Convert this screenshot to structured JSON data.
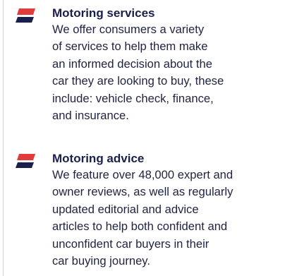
{
  "colors": {
    "flag_red": "#e23b3b",
    "flag_navy": "#1b1f4b",
    "divider": "#cfd2dc"
  },
  "items": [
    {
      "icon": "flag-icon",
      "title": "Motoring services",
      "lines": [
        "We offer consumers a variety",
        "of services to help them make",
        "an informed decision about the",
        "car they are looking to buy, these",
        "include: vehicle check, finance,",
        "and insurance."
      ]
    },
    {
      "icon": "flag-icon",
      "title": "Motoring advice",
      "lines": [
        "We feature over 48,000 expert and",
        "owner reviews, as well as regularly",
        "updated editorial and advice",
        "articles to help both confident and",
        "unconfident car buyers in their",
        "car buying journey."
      ]
    }
  ]
}
